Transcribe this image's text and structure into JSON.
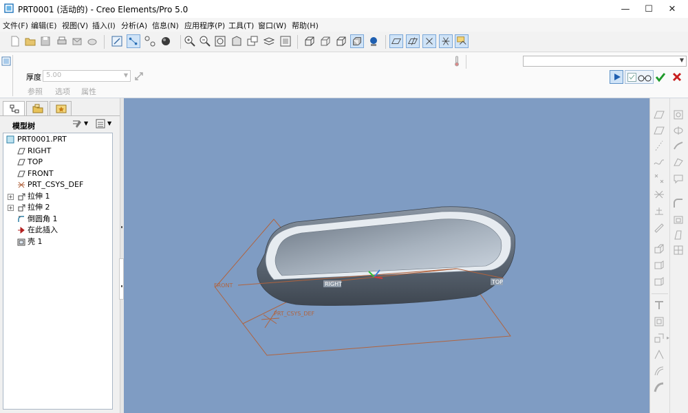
{
  "window": {
    "title": "PRT0001 (活动的) - Creo Elements/Pro 5.0"
  },
  "menu": [
    "文件(F)",
    "编辑(E)",
    "视图(V)",
    "插入(I)",
    "分析(A)",
    "信息(N)",
    "应用程序(P)",
    "工具(T)",
    "窗口(W)",
    "帮助(H)"
  ],
  "dashboard": {
    "thickness_label": "厚度",
    "thickness_value": "5.00",
    "tabs": [
      "参照",
      "选项",
      "属性"
    ]
  },
  "model_tree": {
    "title": "模型树",
    "items": [
      {
        "label": "PRT0001.PRT",
        "icon": "part-icon"
      },
      {
        "label": "RIGHT",
        "icon": "datum-plane-icon"
      },
      {
        "label": "TOP",
        "icon": "datum-plane-icon"
      },
      {
        "label": "FRONT",
        "icon": "datum-plane-icon"
      },
      {
        "label": "PRT_CSYS_DEF",
        "icon": "csys-icon"
      },
      {
        "label": "拉伸 1",
        "icon": "extrude-icon"
      },
      {
        "label": "拉伸 2",
        "icon": "extrude-icon"
      },
      {
        "label": "倒圆角 1",
        "icon": "round-icon"
      },
      {
        "label": "在此插入",
        "icon": "insert-here-icon"
      },
      {
        "label": "壳 1",
        "icon": "shell-icon"
      }
    ]
  },
  "viewport_labels": {
    "front": "FRONT",
    "right": "RIGHT",
    "top": "TOP",
    "csys": "PRT_CSYS_DEF"
  },
  "colors": {
    "viewport_bg": "#7f9cc3",
    "datum_line": "#b1633d",
    "accept": "#1e9a2a",
    "cancel": "#c81e1e"
  }
}
